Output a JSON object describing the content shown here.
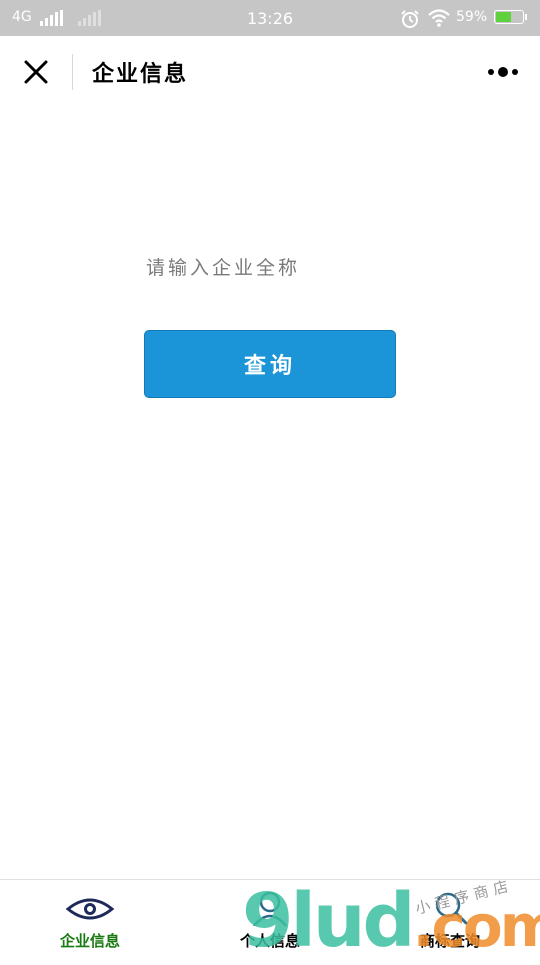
{
  "status_bar": {
    "network": "4G",
    "time": "13:26",
    "battery": "59%",
    "battery_level": 0.59,
    "icons": [
      "signal-icon",
      "alarm-icon",
      "wifi-icon",
      "battery-icon"
    ]
  },
  "nav": {
    "title": "企业信息",
    "close_icon": "close-icon",
    "more_icon": "more-icon"
  },
  "main": {
    "input_placeholder": "请输入企业全称",
    "input_value": "",
    "query_button": "查询",
    "accent_color": "#1b95d8"
  },
  "tabbar": {
    "tabs": [
      {
        "label": "企业信息",
        "icon": "eye-icon",
        "active": true,
        "color": "#1a7a12"
      },
      {
        "label": "个人信息",
        "icon": "person-icon",
        "active": false,
        "color": "#000000"
      },
      {
        "label": "商标查询",
        "icon": "search-icon",
        "active": false,
        "color": "#000000"
      }
    ]
  },
  "watermark": {
    "main": "9lud",
    "suffix": ".com",
    "sub": "小程序商店"
  }
}
